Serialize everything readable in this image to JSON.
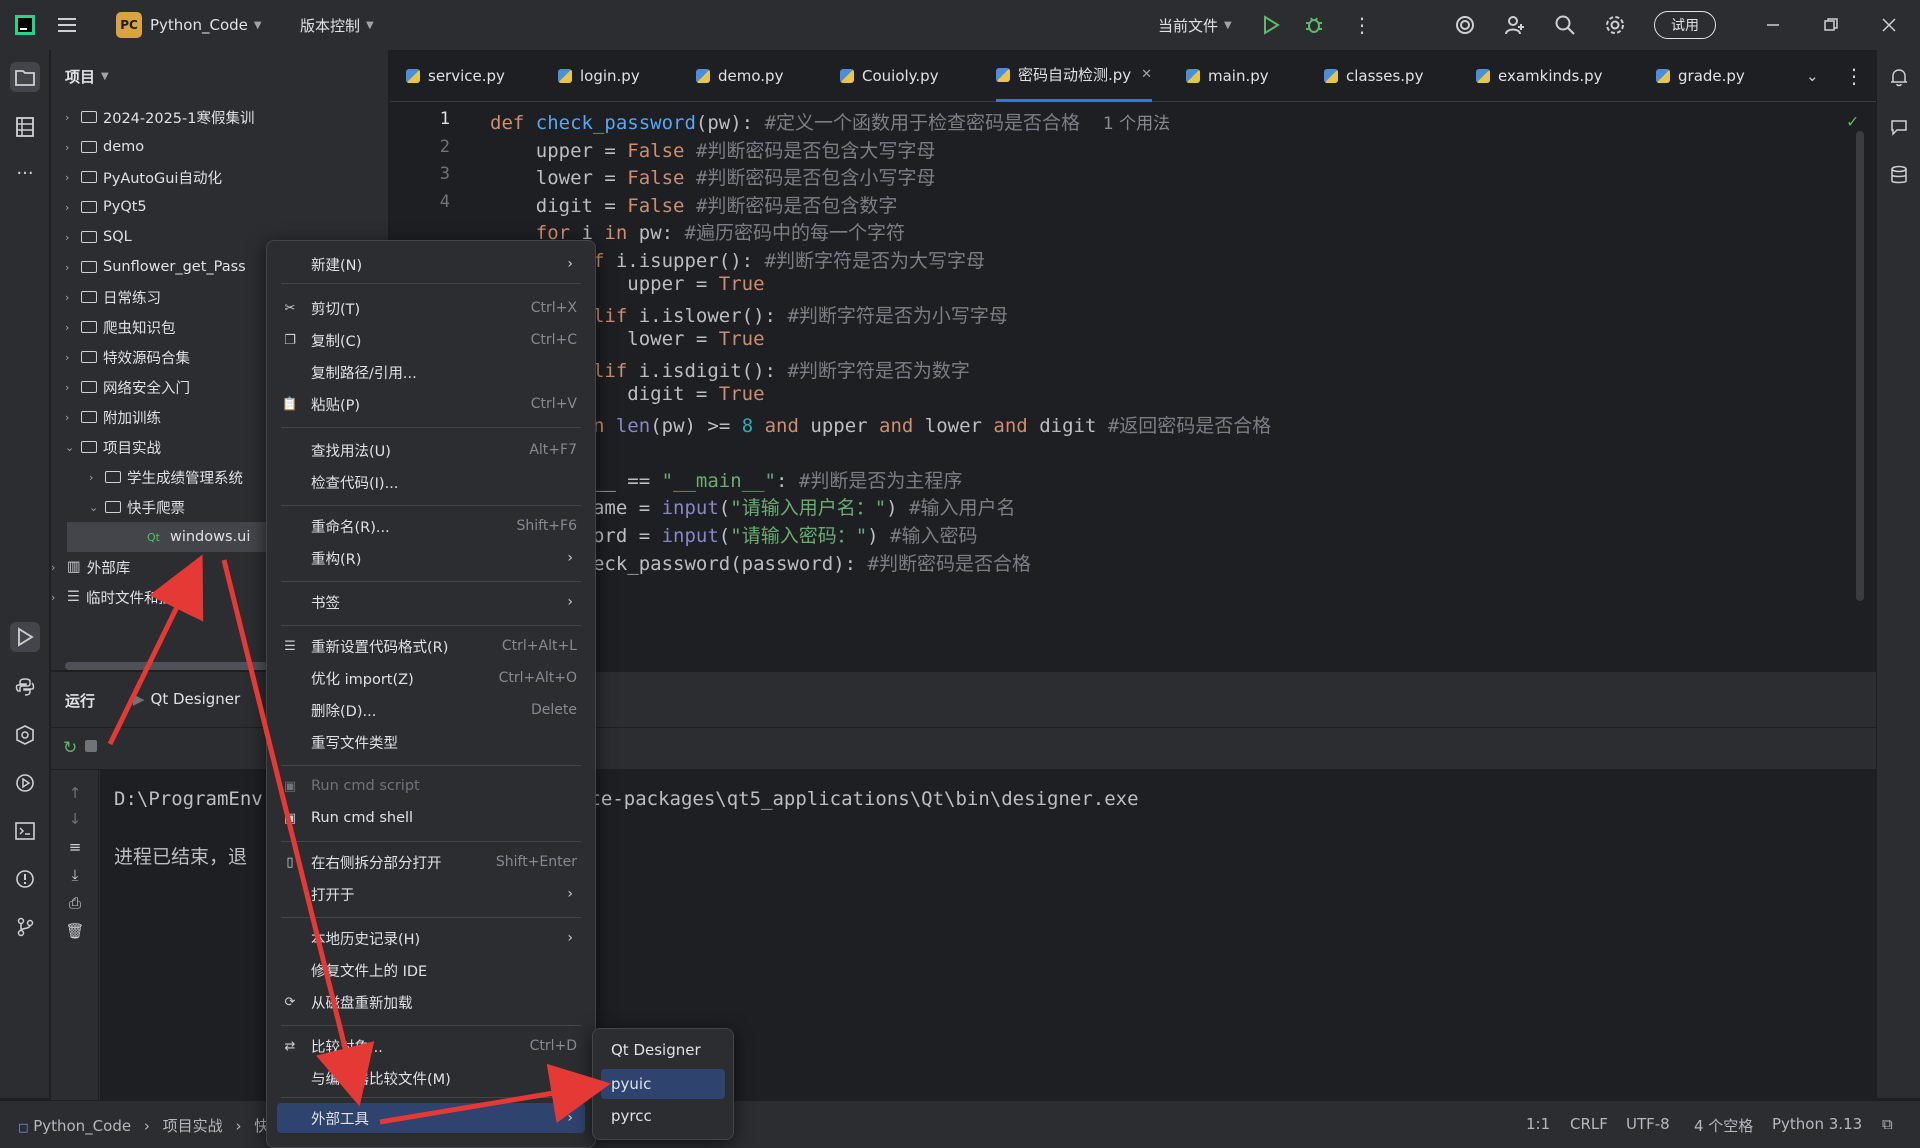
{
  "titlebar": {
    "badge": "PC",
    "project": "Python_Code",
    "vcs": "版本控制",
    "run_config": "当前文件",
    "trial": "试用"
  },
  "project_panel": {
    "title": "项目",
    "items": [
      {
        "label": "2024-2025-1寒假集训"
      },
      {
        "label": "demo"
      },
      {
        "label": "PyAutoGui自动化"
      },
      {
        "label": "PyQt5"
      },
      {
        "label": "SQL"
      },
      {
        "label": "Sunflower_get_Pass"
      },
      {
        "label": "日常练习"
      },
      {
        "label": "爬虫知识包"
      },
      {
        "label": "特效源码合集"
      },
      {
        "label": "网络安全入门"
      },
      {
        "label": "附加训练"
      },
      {
        "label": "项目实战"
      },
      {
        "label": "学生成绩管理系统"
      },
      {
        "label": "快手爬票"
      },
      {
        "label": "windows.ui"
      },
      {
        "label": "外部库"
      },
      {
        "label": "临时文件和控制台"
      }
    ]
  },
  "tabs": [
    {
      "label": "service.py"
    },
    {
      "label": "login.py"
    },
    {
      "label": "demo.py"
    },
    {
      "label": "Couioly.py"
    },
    {
      "label": "密码自动检测.py"
    },
    {
      "label": "main.py"
    },
    {
      "label": "classes.py"
    },
    {
      "label": "examkinds.py"
    },
    {
      "label": "grade.py"
    }
  ],
  "editor": {
    "line_numbers": [
      "1",
      "2",
      "3",
      "4"
    ],
    "usage_hint": "1 个用法"
  },
  "run_panel": {
    "title": "运行",
    "tab": "Qt Designer",
    "console_line1_a": "D:\\ProgramEnv",
    "console_line1_b": "ite-packages\\qt5_applications\\Qt\\bin\\designer.exe",
    "console_line2": "进程已结束，退"
  },
  "context_menu": {
    "items": [
      {
        "label": "新建(N)",
        "shortcut": "",
        "sub": true
      },
      {
        "label": "剪切(T)",
        "shortcut": "Ctrl+X"
      },
      {
        "label": "复制(C)",
        "shortcut": "Ctrl+C"
      },
      {
        "label": "复制路径/引用...",
        "shortcut": ""
      },
      {
        "label": "粘贴(P)",
        "shortcut": "Ctrl+V"
      },
      {
        "label": "查找用法(U)",
        "shortcut": "Alt+F7"
      },
      {
        "label": "检查代码(I)...",
        "shortcut": ""
      },
      {
        "label": "重命名(R)...",
        "shortcut": "Shift+F6"
      },
      {
        "label": "重构(R)",
        "shortcut": ""
      },
      {
        "label": "书签",
        "shortcut": ""
      },
      {
        "label": "重新设置代码格式(R)",
        "shortcut": "Ctrl+Alt+L"
      },
      {
        "label": "优化 import(Z)",
        "shortcut": "Ctrl+Alt+O"
      },
      {
        "label": "删除(D)...",
        "shortcut": "Delete"
      },
      {
        "label": "重写文件类型",
        "shortcut": ""
      },
      {
        "label": "Run cmd script",
        "shortcut": ""
      },
      {
        "label": "Run cmd shell",
        "shortcut": ""
      },
      {
        "label": "在右侧拆分部分打开",
        "shortcut": "Shift+Enter"
      },
      {
        "label": "打开于",
        "shortcut": ""
      },
      {
        "label": "本地历史记录(H)",
        "shortcut": ""
      },
      {
        "label": "修复文件上的 IDE",
        "shortcut": ""
      },
      {
        "label": "从磁盘重新加载",
        "shortcut": ""
      },
      {
        "label": "比较对象...",
        "shortcut": "Ctrl+D"
      },
      {
        "label": "与编辑器比较文件(M)",
        "shortcut": ""
      },
      {
        "label": "外部工具",
        "shortcut": ""
      }
    ]
  },
  "submenu": {
    "items": [
      {
        "label": "Qt Designer"
      },
      {
        "label": "pyuic"
      },
      {
        "label": "pyrcc"
      }
    ]
  },
  "statusbar": {
    "crumb1": "Python_Code",
    "crumb2": "项目实战",
    "crumb3": "快",
    "pos": "1:1",
    "eol": "CRLF",
    "enc": "UTF-8",
    "indent": "4 个空格",
    "interp": "Python 3.13"
  },
  "colors": {
    "accent": "#3574f0",
    "arrow": "#e53935",
    "highlight": "#2e436e"
  }
}
